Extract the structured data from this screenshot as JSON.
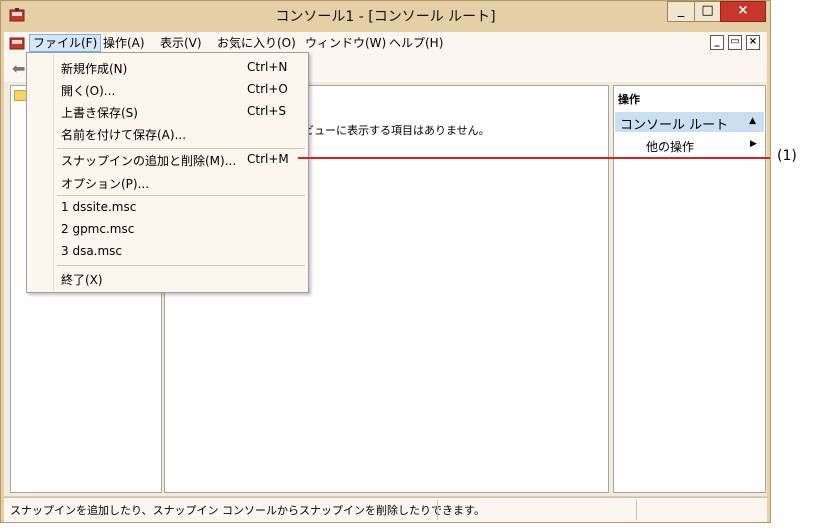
{
  "window": {
    "title": "コンソール1 - [コンソール ルート]",
    "minimize": "_",
    "maximize": "□",
    "close": "×"
  },
  "menubar": {
    "items": [
      "ファイル(F)",
      "操作(A)",
      "表示(V)",
      "お気に入り(O)",
      "ウィンドウ(W)",
      "ヘルプ(H)"
    ],
    "mdi_buttons": [
      "_",
      "▭",
      "×"
    ]
  },
  "file_menu": {
    "items": [
      {
        "label": "新規作成(N)",
        "shortcut": "Ctrl+N"
      },
      {
        "label": "開く(O)...",
        "shortcut": "Ctrl+O"
      },
      {
        "label": "上書き保存(S)",
        "shortcut": "Ctrl+S"
      },
      {
        "label": "名前を付けて保存(A)...",
        "shortcut": ""
      },
      {
        "label": "スナップインの追加と削除(M)...",
        "shortcut": "Ctrl+M"
      },
      {
        "label": "オプション(P)...",
        "shortcut": ""
      },
      {
        "label": "1 dssite.msc",
        "shortcut": ""
      },
      {
        "label": "2 gpmc.msc",
        "shortcut": ""
      },
      {
        "label": "3 dsa.msc",
        "shortcut": ""
      },
      {
        "label": "終了(X)",
        "shortcut": ""
      }
    ]
  },
  "center_pane": {
    "message": "ビューに表示する項目はありません。"
  },
  "actions_pane": {
    "header": "操作",
    "section": "コンソール ルート",
    "item": "他の操作"
  },
  "statusbar": {
    "text": "スナップインを追加したり、スナップイン コンソールからスナップインを削除したりできます。"
  },
  "callout": {
    "label": "(1)"
  },
  "colors": {
    "frame": "#e4cfa6",
    "menu_highlight": "#d5e6f6",
    "action_section": "#cbdff2",
    "callout_line": "#d6202a",
    "close_button": "#c7362b"
  }
}
